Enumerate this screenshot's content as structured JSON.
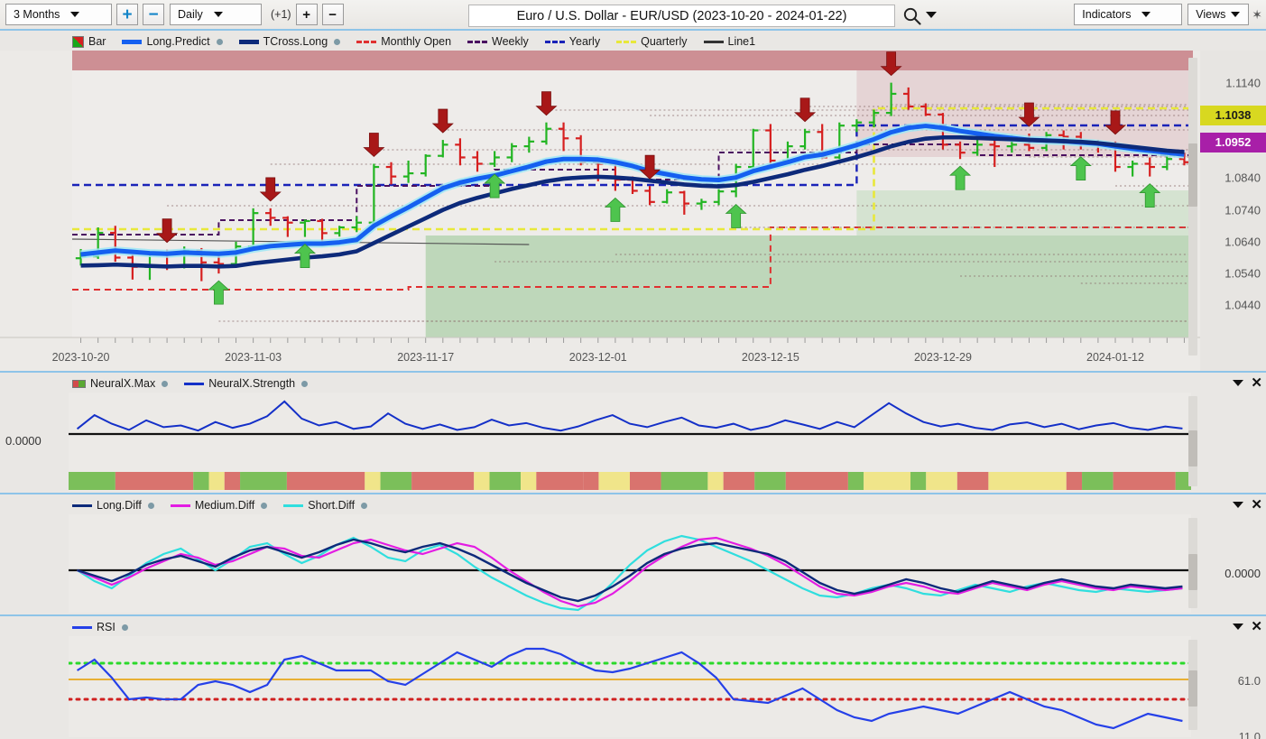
{
  "toolbar": {
    "period_select": {
      "value": "3 Months",
      "icon": "chevron-down-icon"
    },
    "zoom_in_label": "+",
    "zoom_out_label": "−",
    "interval_select": {
      "value": "Daily",
      "icon": "chevron-down-icon"
    },
    "offset_label": "(+1)",
    "bar_plus_label": "+",
    "bar_minus_label": "−",
    "chart_title": "Euro / U.S. Dollar - EUR/USD (2023-10-20 - 2024-01-22)",
    "search_icon": "search-icon",
    "search_caret": "chevron-down-icon",
    "indicators_select": {
      "value": "Indicators",
      "icon": "chevron-down-icon"
    },
    "views_select": {
      "value": "Views",
      "icon": "chevron-down-icon"
    },
    "pin_label": "✶"
  },
  "price_panel": {
    "legend": [
      {
        "label": "Bar",
        "type": "bar-swatch",
        "color": "#17a81a",
        "dot": false
      },
      {
        "label": "Long.Predict",
        "type": "thick",
        "color": "#1560f0",
        "dot": true
      },
      {
        "label": "TCross.Long",
        "type": "thick",
        "color": "#0d2a7a",
        "dot": true
      },
      {
        "label": "Monthly Open",
        "type": "dash",
        "color": "#e03030",
        "dot": false
      },
      {
        "label": "Weekly",
        "type": "dash",
        "color": "#4a1060",
        "dot": false
      },
      {
        "label": "Yearly",
        "type": "dash",
        "color": "#1a23b8",
        "dot": false
      },
      {
        "label": "Quarterly",
        "type": "dash",
        "color": "#e8e83a",
        "dot": false
      },
      {
        "label": "Line1",
        "type": "line",
        "color": "#333333",
        "dot": false
      }
    ],
    "y_ticks": [
      "1.1140",
      "1.0840",
      "1.0740",
      "1.0640",
      "1.0540",
      "1.0440"
    ],
    "y_tag_yellow": {
      "value": "1.1038",
      "bg": "#d8d820",
      "fg": "#1a1a1a"
    },
    "y_tag_magenta": {
      "value": "1.0952",
      "bg": "#a81fa8",
      "fg": "#ffffff"
    },
    "x_labels": [
      "2023-10-20",
      "2023-11-03",
      "2023-11-17",
      "2023-12-01",
      "2023-12-15",
      "2023-12-29",
      "2024-01-12"
    ],
    "zone_top_color": "#c77f85",
    "zone_green_color": "#9ec99a"
  },
  "neuralx_panel": {
    "legend": [
      {
        "label": "NeuralX.Max",
        "type": "nx-swatch",
        "color": "#5aa832",
        "dot": true
      },
      {
        "label": "NeuralX.Strength",
        "type": "line",
        "color": "#1430c8",
        "dot": true
      }
    ],
    "zero_label": "0.0000",
    "panel_menu_icon": "chevron-down-icon",
    "panel_close_icon": "close-icon",
    "strip_colors": {
      "up": "#7bbf5a",
      "down": "#d9736e",
      "neutral": "#f0e58a"
    }
  },
  "diff_panel": {
    "legend": [
      {
        "label": "Long.Diff",
        "type": "line",
        "color": "#0d2a7a",
        "dot": true
      },
      {
        "label": "Medium.Diff",
        "type": "line",
        "color": "#e31ce3",
        "dot": true
      },
      {
        "label": "Short.Diff",
        "type": "line",
        "color": "#2fdede",
        "dot": true
      }
    ],
    "zero_label": "0.0000",
    "panel_menu_icon": "chevron-down-icon",
    "panel_close_icon": "close-icon"
  },
  "rsi_panel": {
    "legend": [
      {
        "label": "RSI",
        "type": "line",
        "color": "#2540e8",
        "dot": true
      }
    ],
    "y_top_label": "61.0",
    "y_bottom_label": "11.0",
    "panel_menu_icon": "chevron-down-icon",
    "panel_close_icon": "close-icon",
    "overbought_color": "#2ad92a",
    "mid_color": "#e8a81a",
    "oversold_color": "#d02020"
  },
  "chart_data": {
    "type": "line",
    "title": "Euro / U.S. Dollar - EUR/USD (2023-10-20 - 2024-01-22)",
    "symbol": "EUR/USD",
    "interval": "Daily",
    "range": "3 Months",
    "date_start": "2023-10-20",
    "date_end": "2024-01-22",
    "xlabel": "",
    "ylabel": "",
    "ylim": [
      1.039,
      1.119
    ],
    "y_ticks": [
      1.114,
      1.1038,
      1.0952,
      1.084,
      1.074,
      1.064,
      1.054,
      1.044
    ],
    "current_price": 1.0952,
    "predict_level": 1.1038,
    "grid": false,
    "legend_position": "top-left",
    "ohlc": [
      {
        "d": "2023-10-20",
        "o": 1.0588,
        "h": 1.0617,
        "l": 1.0565,
        "c": 1.0594,
        "dir": "up"
      },
      {
        "d": "2023-10-23",
        "o": 1.0594,
        "h": 1.0685,
        "l": 1.0586,
        "c": 1.0668,
        "dir": "up"
      },
      {
        "d": "2023-10-24",
        "o": 1.0668,
        "h": 1.069,
        "l": 1.0577,
        "c": 1.059,
        "dir": "down"
      },
      {
        "d": "2023-10-25",
        "o": 1.059,
        "h": 1.06,
        "l": 1.0521,
        "c": 1.0561,
        "dir": "down"
      },
      {
        "d": "2023-10-26",
        "o": 1.0561,
        "h": 1.06,
        "l": 1.052,
        "c": 1.0565,
        "dir": "up"
      },
      {
        "d": "2023-10-27",
        "o": 1.0565,
        "h": 1.0615,
        "l": 1.0551,
        "c": 1.0561,
        "dir": "down"
      },
      {
        "d": "2023-10-30",
        "o": 1.0561,
        "h": 1.0625,
        "l": 1.0556,
        "c": 1.0612,
        "dir": "up"
      },
      {
        "d": "2023-10-31",
        "o": 1.0612,
        "h": 1.062,
        "l": 1.0516,
        "c": 1.0575,
        "dir": "down"
      },
      {
        "d": "2023-11-01",
        "o": 1.0575,
        "h": 1.0595,
        "l": 1.054,
        "c": 1.057,
        "dir": "down"
      },
      {
        "d": "2023-11-02",
        "o": 1.057,
        "h": 1.064,
        "l": 1.056,
        "c": 1.0625,
        "dir": "up"
      },
      {
        "d": "2023-11-03",
        "o": 1.0625,
        "h": 1.0745,
        "l": 1.0615,
        "c": 1.073,
        "dir": "up"
      },
      {
        "d": "2023-11-06",
        "o": 1.073,
        "h": 1.0745,
        "l": 1.069,
        "c": 1.0715,
        "dir": "down"
      },
      {
        "d": "2023-11-07",
        "o": 1.0715,
        "h": 1.072,
        "l": 1.0655,
        "c": 1.07,
        "dir": "down"
      },
      {
        "d": "2023-11-08",
        "o": 1.07,
        "h": 1.071,
        "l": 1.0655,
        "c": 1.0705,
        "dir": "up"
      },
      {
        "d": "2023-11-09",
        "o": 1.0705,
        "h": 1.0712,
        "l": 1.064,
        "c": 1.0667,
        "dir": "down"
      },
      {
        "d": "2023-11-10",
        "o": 1.0667,
        "h": 1.069,
        "l": 1.0656,
        "c": 1.0685,
        "dir": "up"
      },
      {
        "d": "2023-11-13",
        "o": 1.0685,
        "h": 1.072,
        "l": 1.067,
        "c": 1.07,
        "dir": "up"
      },
      {
        "d": "2023-11-14",
        "o": 1.07,
        "h": 1.0885,
        "l": 1.069,
        "c": 1.0875,
        "dir": "up"
      },
      {
        "d": "2023-11-15",
        "o": 1.0875,
        "h": 1.089,
        "l": 1.082,
        "c": 1.0845,
        "dir": "down"
      },
      {
        "d": "2023-11-16",
        "o": 1.0845,
        "h": 1.0895,
        "l": 1.0825,
        "c": 1.0855,
        "dir": "up"
      },
      {
        "d": "2023-11-17",
        "o": 1.0855,
        "h": 1.0915,
        "l": 1.0845,
        "c": 1.091,
        "dir": "up"
      },
      {
        "d": "2023-11-20",
        "o": 1.091,
        "h": 1.096,
        "l": 1.0905,
        "c": 1.0945,
        "dir": "up"
      },
      {
        "d": "2023-11-21",
        "o": 1.0945,
        "h": 1.0965,
        "l": 1.088,
        "c": 1.0905,
        "dir": "down"
      },
      {
        "d": "2023-11-22",
        "o": 1.0905,
        "h": 1.0925,
        "l": 1.086,
        "c": 1.0885,
        "dir": "down"
      },
      {
        "d": "2023-11-23",
        "o": 1.0885,
        "h": 1.0925,
        "l": 1.0875,
        "c": 1.0905,
        "dir": "up"
      },
      {
        "d": "2023-11-24",
        "o": 1.0905,
        "h": 1.095,
        "l": 1.089,
        "c": 1.094,
        "dir": "up"
      },
      {
        "d": "2023-11-27",
        "o": 1.094,
        "h": 1.097,
        "l": 1.092,
        "c": 1.0955,
        "dir": "up"
      },
      {
        "d": "2023-11-28",
        "o": 1.0955,
        "h": 1.1015,
        "l": 1.0945,
        "c": 1.0995,
        "dir": "up"
      },
      {
        "d": "2023-11-29",
        "o": 1.0995,
        "h": 1.1015,
        "l": 1.0925,
        "c": 1.0965,
        "dir": "down"
      },
      {
        "d": "2023-11-30",
        "o": 1.0965,
        "h": 1.0975,
        "l": 1.088,
        "c": 1.089,
        "dir": "down"
      },
      {
        "d": "2023-12-01",
        "o": 1.089,
        "h": 1.0905,
        "l": 1.083,
        "c": 1.0885,
        "dir": "down"
      },
      {
        "d": "2023-12-04",
        "o": 1.0885,
        "h": 1.089,
        "l": 1.08,
        "c": 1.0835,
        "dir": "down"
      },
      {
        "d": "2023-12-05",
        "o": 1.0835,
        "h": 1.0845,
        "l": 1.079,
        "c": 1.08,
        "dir": "down"
      },
      {
        "d": "2023-12-06",
        "o": 1.08,
        "h": 1.0815,
        "l": 1.0755,
        "c": 1.0765,
        "dir": "down"
      },
      {
        "d": "2023-12-07",
        "o": 1.0765,
        "h": 1.0805,
        "l": 1.076,
        "c": 1.0795,
        "dir": "up"
      },
      {
        "d": "2023-12-08",
        "o": 1.0795,
        "h": 1.08,
        "l": 1.0725,
        "c": 1.076,
        "dir": "down"
      },
      {
        "d": "2023-12-11",
        "o": 1.076,
        "h": 1.0775,
        "l": 1.074,
        "c": 1.0765,
        "dir": "up"
      },
      {
        "d": "2023-12-12",
        "o": 1.0765,
        "h": 1.0805,
        "l": 1.0755,
        "c": 1.0798,
        "dir": "up"
      },
      {
        "d": "2023-12-13",
        "o": 1.0798,
        "h": 1.0885,
        "l": 1.078,
        "c": 1.0875,
        "dir": "up"
      },
      {
        "d": "2023-12-14",
        "o": 1.0875,
        "h": 1.0995,
        "l": 1.0865,
        "c": 1.099,
        "dir": "up"
      },
      {
        "d": "2023-12-15",
        "o": 1.099,
        "h": 1.101,
        "l": 1.088,
        "c": 1.0895,
        "dir": "down"
      },
      {
        "d": "2023-12-18",
        "o": 1.0895,
        "h": 1.0955,
        "l": 1.0885,
        "c": 1.094,
        "dir": "up"
      },
      {
        "d": "2023-12-19",
        "o": 1.094,
        "h": 1.0995,
        "l": 1.093,
        "c": 1.0985,
        "dir": "up"
      },
      {
        "d": "2023-12-20",
        "o": 1.0985,
        "h": 1.101,
        "l": 1.09,
        "c": 1.0905,
        "dir": "down"
      },
      {
        "d": "2023-12-21",
        "o": 1.0905,
        "h": 1.1015,
        "l": 1.09,
        "c": 1.1005,
        "dir": "up"
      },
      {
        "d": "2023-12-22",
        "o": 1.1005,
        "h": 1.1025,
        "l": 1.0985,
        "c": 1.1015,
        "dir": "up"
      },
      {
        "d": "2023-12-26",
        "o": 1.1015,
        "h": 1.1055,
        "l": 1.1,
        "c": 1.1045,
        "dir": "up"
      },
      {
        "d": "2023-12-27",
        "o": 1.1045,
        "h": 1.114,
        "l": 1.1035,
        "c": 1.1105,
        "dir": "up"
      },
      {
        "d": "2023-12-28",
        "o": 1.1105,
        "h": 1.1125,
        "l": 1.1055,
        "c": 1.1065,
        "dir": "down"
      },
      {
        "d": "2023-12-29",
        "o": 1.1065,
        "h": 1.1075,
        "l": 1.1035,
        "c": 1.104,
        "dir": "down"
      },
      {
        "d": "2024-01-02",
        "o": 1.104,
        "h": 1.1045,
        "l": 1.093,
        "c": 1.0945,
        "dir": "down"
      },
      {
        "d": "2024-01-03",
        "o": 1.0945,
        "h": 1.0955,
        "l": 1.09,
        "c": 1.092,
        "dir": "down"
      },
      {
        "d": "2024-01-04",
        "o": 1.092,
        "h": 1.0965,
        "l": 1.091,
        "c": 1.0945,
        "dir": "up"
      },
      {
        "d": "2024-01-05",
        "o": 1.0945,
        "h": 1.096,
        "l": 1.0875,
        "c": 1.094,
        "dir": "down"
      },
      {
        "d": "2024-01-08",
        "o": 1.094,
        "h": 1.0975,
        "l": 1.092,
        "c": 1.0945,
        "dir": "up"
      },
      {
        "d": "2024-01-09",
        "o": 1.0945,
        "h": 1.098,
        "l": 1.0925,
        "c": 1.0935,
        "dir": "down"
      },
      {
        "d": "2024-01-10",
        "o": 1.0935,
        "h": 1.0985,
        "l": 1.0925,
        "c": 1.0975,
        "dir": "up"
      },
      {
        "d": "2024-01-11",
        "o": 1.0975,
        "h": 1.099,
        "l": 1.093,
        "c": 1.097,
        "dir": "down"
      },
      {
        "d": "2024-01-12",
        "o": 1.097,
        "h": 1.0985,
        "l": 1.093,
        "c": 1.095,
        "dir": "down"
      },
      {
        "d": "2024-01-15",
        "o": 1.095,
        "h": 1.096,
        "l": 1.092,
        "c": 1.0945,
        "dir": "down"
      },
      {
        "d": "2024-01-16",
        "o": 1.0945,
        "h": 1.0955,
        "l": 1.086,
        "c": 1.0875,
        "dir": "down"
      },
      {
        "d": "2024-01-17",
        "o": 1.0875,
        "h": 1.0895,
        "l": 1.0845,
        "c": 1.0885,
        "dir": "up"
      },
      {
        "d": "2024-01-18",
        "o": 1.0885,
        "h": 1.0905,
        "l": 1.0845,
        "c": 1.0875,
        "dir": "down"
      },
      {
        "d": "2024-01-19",
        "o": 1.0875,
        "h": 1.0925,
        "l": 1.0865,
        "c": 1.09,
        "dir": "up"
      },
      {
        "d": "2024-01-22",
        "o": 1.09,
        "h": 1.092,
        "l": 1.088,
        "c": 1.089,
        "dir": "down"
      }
    ],
    "series": [
      {
        "name": "Long.Predict",
        "color": "#1560f0",
        "values": [
          1.06,
          1.0606,
          1.0612,
          1.0608,
          1.0604,
          1.0602,
          1.0606,
          1.0604,
          1.0602,
          1.0606,
          1.0618,
          1.0626,
          1.063,
          1.0634,
          1.0634,
          1.0638,
          1.0646,
          1.069,
          1.072,
          1.0748,
          1.0778,
          1.0808,
          1.0826,
          1.0838,
          1.0848,
          1.0862,
          1.0876,
          1.0892,
          1.09,
          1.09,
          1.0898,
          1.089,
          1.0878,
          1.0862,
          1.0852,
          1.0842,
          1.0836,
          1.0834,
          1.0842,
          1.0862,
          1.0876,
          1.089,
          1.0906,
          1.0914,
          1.0928,
          1.0944,
          1.0962,
          1.0984,
          1.0998,
          1.1004,
          1.0998,
          1.0988,
          1.098,
          1.0972,
          1.0966,
          1.096,
          1.0958,
          1.0956,
          1.0952,
          1.0948,
          1.094,
          1.0932,
          1.0926,
          1.092,
          1.0914
        ]
      },
      {
        "name": "TCross.Long",
        "color": "#0d2a7a",
        "values": [
          1.0565,
          1.0566,
          1.0568,
          1.0566,
          1.0564,
          1.0562,
          1.0564,
          1.0564,
          1.0562,
          1.0564,
          1.0572,
          1.0578,
          1.0584,
          1.059,
          1.0594,
          1.06,
          1.061,
          1.0636,
          1.0662,
          1.0688,
          1.0714,
          1.074,
          1.0762,
          1.0778,
          1.0792,
          1.0806,
          1.0818,
          1.083,
          1.0838,
          1.0842,
          1.0844,
          1.0842,
          1.0838,
          1.0832,
          1.0826,
          1.082,
          1.0816,
          1.0814,
          1.0818,
          1.0828,
          1.084,
          1.0852,
          1.0866,
          1.0878,
          1.0892,
          1.0906,
          1.0922,
          1.094,
          1.0954,
          1.0964,
          1.0968,
          1.0968,
          1.0966,
          1.0964,
          1.0962,
          1.096,
          1.0958,
          1.0956,
          1.0954,
          1.095,
          1.0944,
          1.0938,
          1.0932,
          1.0926,
          1.0922
        ]
      }
    ],
    "horizontal_levels": [
      {
        "name": "Monthly Open",
        "color": "#e03030",
        "style": "dashed"
      },
      {
        "name": "Weekly",
        "color": "#4a1060",
        "style": "dashed"
      },
      {
        "name": "Yearly",
        "color": "#1a23b8",
        "style": "dashed"
      },
      {
        "name": "Quarterly",
        "color": "#e8e83a",
        "style": "dashed"
      },
      {
        "name": "Line1",
        "color": "#333333",
        "style": "solid"
      }
    ],
    "signals": {
      "sell_arrow_indices": [
        5,
        11,
        17,
        21,
        27,
        33,
        42,
        47,
        55,
        60
      ],
      "buy_arrow_indices": [
        8,
        13,
        24,
        31,
        38,
        51,
        58,
        62
      ]
    },
    "subcharts": [
      {
        "name": "NeuralX",
        "type": "line",
        "zero_line": 0.0,
        "series": [
          {
            "name": "NeuralX.Strength",
            "color": "#1430c8"
          }
        ],
        "strip": {
          "name": "NeuralX.Max",
          "states": [
            "up",
            "down",
            "up",
            "neutral",
            "down",
            "up",
            "down",
            "neutral",
            "up",
            "down",
            "neutral",
            "up",
            "neutral",
            "down",
            "down",
            "neutral",
            "down",
            "up",
            "neutral",
            "down",
            "up",
            "down",
            "up",
            "neutral",
            "up",
            "neutral",
            "down",
            "neutral",
            "down",
            "up",
            "down",
            "up"
          ]
        }
      },
      {
        "name": "Diff",
        "type": "line",
        "zero_line": 0.0,
        "series": [
          {
            "name": "Long.Diff",
            "color": "#0d2a7a"
          },
          {
            "name": "Medium.Diff",
            "color": "#e31ce3"
          },
          {
            "name": "Short.Diff",
            "color": "#2fdede"
          }
        ]
      },
      {
        "name": "RSI",
        "type": "line",
        "ylim": [
          11.0,
          61.0
        ],
        "levels": [
          {
            "value": 50,
            "color": "#2ad92a",
            "style": "dotted"
          },
          {
            "value": 41,
            "color": "#e8a81a",
            "style": "solid"
          },
          {
            "value": 30,
            "color": "#d02020",
            "style": "dotted"
          }
        ],
        "series": [
          {
            "name": "RSI",
            "color": "#2540e8"
          }
        ]
      }
    ]
  }
}
